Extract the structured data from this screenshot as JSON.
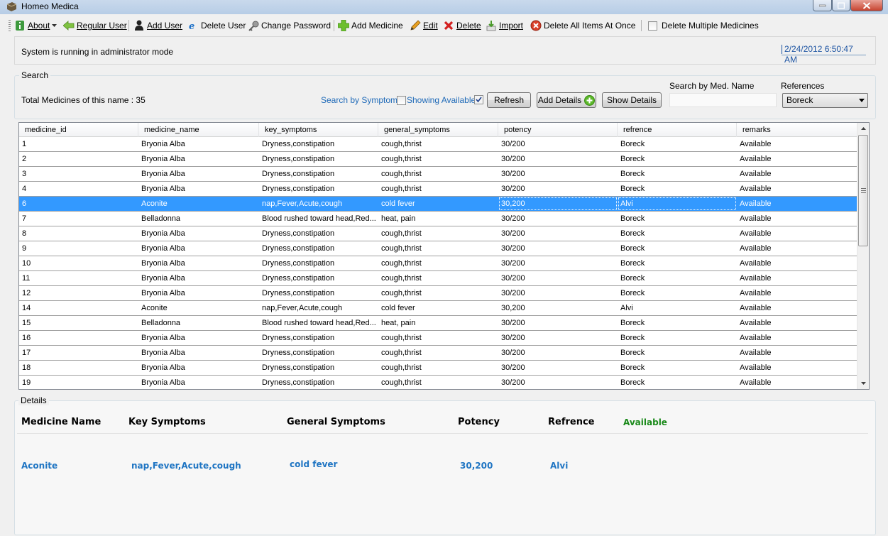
{
  "window": {
    "title": "Homeo Medica"
  },
  "toolbar": {
    "about": "About",
    "regular_user": "Regular User",
    "add_user": "Add User",
    "delete_user": "Delete User",
    "change_password": "Change Password",
    "add_medicine": "Add Medicine",
    "edit": "Edit",
    "delete": "Delete",
    "import": "Import",
    "delete_all": "Delete All Items At Once",
    "delete_multiple": "Delete Multiple Medicines"
  },
  "status": {
    "message": "System is running in administrator mode",
    "datetime": "2/24/2012 6:50:47 AM"
  },
  "search": {
    "group_label": "Search",
    "total_text": "Total Medicines of this name : 35",
    "search_by_symptoms": "Search by Symptoms",
    "showing_available": "Showing Available",
    "refresh": "Refresh",
    "add_details": "Add Details",
    "show_details": "Show Details",
    "search_by_name_label": "Search by Med. Name",
    "search_by_name_value": "",
    "references_label": "References",
    "references_value": "Boreck"
  },
  "grid": {
    "columns": [
      "medicine_id",
      "medicine_name",
      "key_symptoms",
      "general_symptoms",
      "potency",
      "refrence",
      "remarks"
    ],
    "selected_index": 4,
    "rows": [
      [
        "1",
        "Bryonia Alba",
        "Dryness,constipation",
        "cough,thrist",
        "30/200",
        "Boreck",
        "Available"
      ],
      [
        "2",
        "Bryonia Alba",
        "Dryness,constipation",
        "cough,thrist",
        "30/200",
        "Boreck",
        "Available"
      ],
      [
        "3",
        "Bryonia Alba",
        "Dryness,constipation",
        "cough,thrist",
        "30/200",
        "Boreck",
        "Available"
      ],
      [
        "4",
        "Bryonia Alba",
        "Dryness,constipation",
        "cough,thrist",
        "30/200",
        "Boreck",
        "Available"
      ],
      [
        "6",
        "Aconite",
        "nap,Fever,Acute,cough",
        "cold fever",
        "30,200",
        "Alvi",
        "Available"
      ],
      [
        "7",
        "Belladonna",
        "Blood rushed toward head,Red...",
        "heat, pain",
        "30/200",
        "Boreck",
        "Available"
      ],
      [
        "8",
        "Bryonia Alba",
        "Dryness,constipation",
        "cough,thrist",
        "30/200",
        "Boreck",
        "Available"
      ],
      [
        "9",
        "Bryonia Alba",
        "Dryness,constipation",
        "cough,thrist",
        "30/200",
        "Boreck",
        "Available"
      ],
      [
        "10",
        "Bryonia Alba",
        "Dryness,constipation",
        "cough,thrist",
        "30/200",
        "Boreck",
        "Available"
      ],
      [
        "11",
        "Bryonia Alba",
        "Dryness,constipation",
        "cough,thrist",
        "30/200",
        "Boreck",
        "Available"
      ],
      [
        "12",
        "Bryonia Alba",
        "Dryness,constipation",
        "cough,thrist",
        "30/200",
        "Boreck",
        "Available"
      ],
      [
        "14",
        "Aconite",
        "nap,Fever,Acute,cough",
        "cold fever",
        "30,200",
        "Alvi",
        "Available"
      ],
      [
        "15",
        "Belladonna",
        "Blood rushed toward head,Red...",
        "heat, pain",
        "30/200",
        "Boreck",
        "Available"
      ],
      [
        "16",
        "Bryonia Alba",
        "Dryness,constipation",
        "cough,thrist",
        "30/200",
        "Boreck",
        "Available"
      ],
      [
        "17",
        "Bryonia Alba",
        "Dryness,constipation",
        "cough,thrist",
        "30/200",
        "Boreck",
        "Available"
      ],
      [
        "18",
        "Bryonia Alba",
        "Dryness,constipation",
        "cough,thrist",
        "30/200",
        "Boreck",
        "Available"
      ],
      [
        "19",
        "Bryonia Alba",
        "Dryness,constipation",
        "cough,thrist",
        "30/200",
        "Boreck",
        "Available"
      ]
    ]
  },
  "details": {
    "group_label": "Details",
    "headers": {
      "medicine_name": "Medicine Name",
      "key_symptoms": "Key Symptoms",
      "general_symptoms": "General Symptoms",
      "potency": "Potency",
      "refrence": "Refrence",
      "available": "Available"
    },
    "values": {
      "medicine_name": "Aconite",
      "key_symptoms": "nap,Fever,Acute,cough",
      "general_symptoms": "cold fever",
      "potency": "30,200",
      "refrence": "Alvi"
    }
  },
  "colors": {
    "selection": "#3399ff",
    "link_blue": "#1f6ab8",
    "available_green": "#1a8a1a",
    "detail_value_blue": "#1f75c3"
  }
}
